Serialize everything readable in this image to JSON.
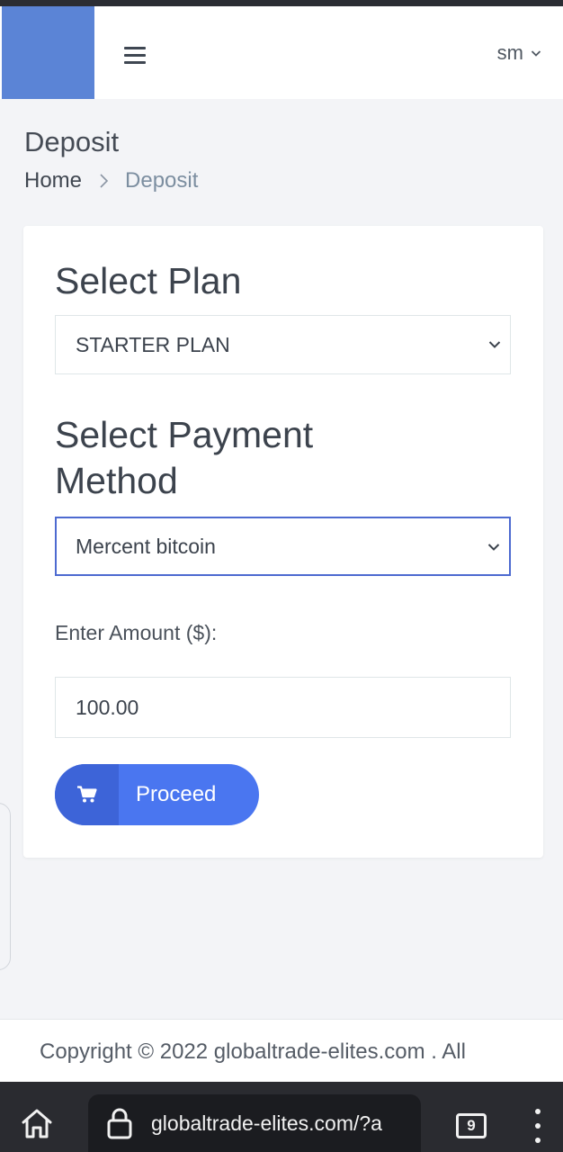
{
  "header": {
    "user_name": "sm"
  },
  "page": {
    "title": "Deposit",
    "breadcrumb": {
      "home": "Home",
      "current": "Deposit"
    }
  },
  "form": {
    "plan_heading": "Select Plan",
    "plan_selected": "STARTER PLAN",
    "payment_heading": "Select Payment Method",
    "payment_selected": "Mercent bitcoin",
    "amount_label": "Enter Amount ($):",
    "amount_value": "100.00",
    "proceed_label": "Proceed"
  },
  "footer": {
    "copyright": "Copyright © 2022 globaltrade-elites.com . All"
  },
  "browser": {
    "url": "globaltrade-elites.com/?a",
    "tab_count": "9"
  },
  "icons": {
    "menu": "hamburger-icon",
    "user_dropdown": "chevron-down-icon",
    "breadcrumb_separator": "chevron-right-icon",
    "select_caret": "chevron-down-icon",
    "proceed": "cart-icon",
    "browser_home": "home-icon",
    "browser_lock": "lock-icon",
    "browser_menu": "overflow-menu-icon"
  },
  "colors": {
    "brand_block": "#5b84d6",
    "primary_button": "#4a76f0",
    "primary_button_icon_bg": "#3d64d8",
    "focus_border": "#4d6ad0",
    "page_background": "#f3f4f7"
  }
}
